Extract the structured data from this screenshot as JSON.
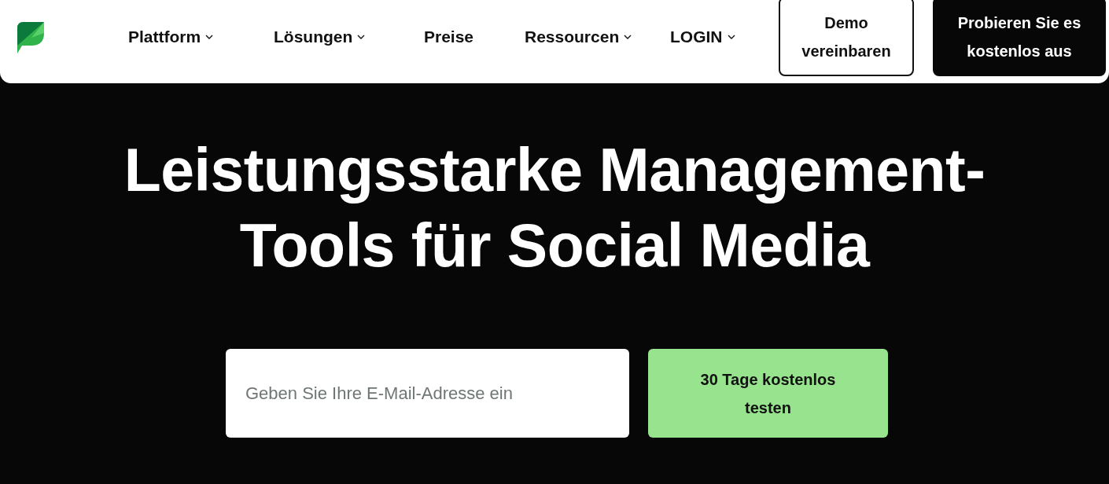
{
  "nav": {
    "items": [
      {
        "label": "Plattform",
        "has_menu": true
      },
      {
        "label": "Lösungen",
        "has_menu": true
      },
      {
        "label": "Preise",
        "has_menu": false
      },
      {
        "label": "Ressourcen",
        "has_menu": true
      },
      {
        "label": "LOGIN",
        "has_menu": true
      }
    ],
    "demo_button": "Demo vereinbaren",
    "trial_button": "Probieren Sie es kostenlos aus"
  },
  "hero": {
    "title": "Leistungsstarke Management-Tools für Social Media",
    "email": {
      "placeholder": "Geben Sie Ihre E-Mail-Adresse ein"
    },
    "submit": "30 Tage kostenlos testen"
  }
}
